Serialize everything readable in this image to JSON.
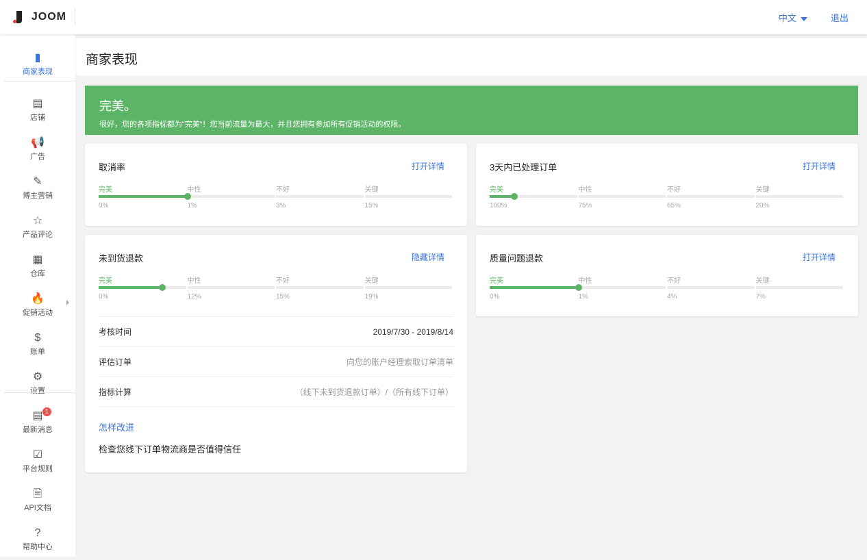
{
  "brand": {
    "name": "JOOM"
  },
  "topbar": {
    "language": "中文",
    "logout": "退出"
  },
  "sidebar": {
    "items": [
      {
        "label": "商家表现",
        "icon": "bar-chart-icon",
        "glyph": "▮",
        "active": true
      },
      {
        "label": "店铺",
        "icon": "store-icon",
        "glyph": "▤"
      },
      {
        "label": "广告",
        "icon": "megaphone-icon",
        "glyph": "📢"
      },
      {
        "label": "博主营销",
        "icon": "blogger-icon",
        "glyph": "✎"
      },
      {
        "label": "产品评论",
        "icon": "star-icon",
        "glyph": "☆"
      },
      {
        "label": "仓库",
        "icon": "warehouse-icon",
        "glyph": "▦"
      },
      {
        "label": "促销活动",
        "icon": "fire-icon",
        "glyph": "🔥",
        "submenu": true
      },
      {
        "label": "账单",
        "icon": "dollar-icon",
        "glyph": "$"
      },
      {
        "label": "设置",
        "icon": "gear-icon",
        "glyph": "⚙"
      },
      {
        "label": "最新消息",
        "icon": "news-icon",
        "glyph": "▤",
        "badge": "1"
      },
      {
        "label": "平台规则",
        "icon": "checklist-icon",
        "glyph": "☑"
      },
      {
        "label": "API文档",
        "icon": "document-icon",
        "glyph": "🗎"
      },
      {
        "label": "帮助中心",
        "icon": "help-icon",
        "glyph": "?"
      }
    ]
  },
  "page": {
    "title": "商家表现"
  },
  "banner": {
    "title": "完美。",
    "message": "很好，您的各项指标都为“完美”！您当前流量为最大，并且您拥有参加所有促销活动的权限。",
    "color": "#5cb567"
  },
  "levels": [
    "完美",
    "中性",
    "不好",
    "关键"
  ],
  "cards": [
    {
      "title": "取消率",
      "link": "打开详情",
      "thresholds": [
        "0%",
        "1%",
        "3%",
        "15%"
      ],
      "progress_percent": 25
    },
    {
      "title": "3天内已处理订单",
      "link": "打开详情",
      "thresholds": [
        "100%",
        "75%",
        "65%",
        "20%"
      ],
      "progress_percent": 7
    },
    {
      "title": "未到货退款",
      "link": "隐藏详情",
      "thresholds": [
        "0%",
        "12%",
        "15%",
        "19%"
      ],
      "progress_percent": 18,
      "details": [
        {
          "key": "考核时间",
          "value": "2019/7/30 - 2019/8/14"
        },
        {
          "key": "评估订单",
          "value": "向您的账户经理索取订单清单"
        },
        {
          "key": "指标计算",
          "value": "（线下未到货退款订单）/（所有线下订单）"
        }
      ],
      "improve_title": "怎样改进",
      "improve_tip": "检查您线下订单物流商是否值得信任"
    },
    {
      "title": "质量问题退款",
      "link": "打开详情",
      "thresholds": [
        "0%",
        "1%",
        "4%",
        "7%"
      ],
      "progress_percent": 25
    }
  ]
}
